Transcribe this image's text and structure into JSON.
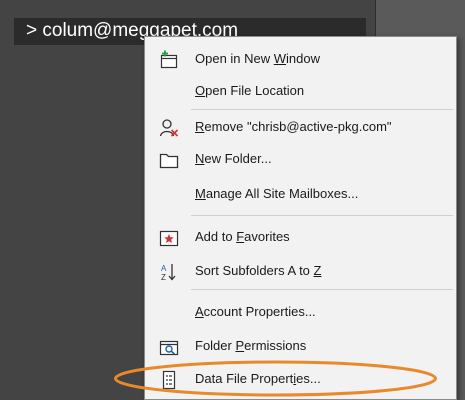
{
  "account": {
    "label": "> colum@meggapet.com"
  },
  "context_menu": {
    "items": [
      {
        "before": "Open in New ",
        "key": "W",
        "after": "indow",
        "icon": "new-window-icon"
      },
      {
        "before": "",
        "key": "O",
        "after": "pen File Location",
        "icon": ""
      },
      {
        "before": "",
        "key": "R",
        "after": "emove \"chrisb@active-pkg.com\"",
        "icon": "remove-account-icon"
      },
      {
        "before": "",
        "key": "N",
        "after": "ew Folder...",
        "icon": "folder-icon"
      },
      {
        "before": "",
        "key": "M",
        "after": "anage All Site Mailboxes...",
        "icon": ""
      },
      {
        "before": "Add to ",
        "key": "F",
        "after": "avorites",
        "icon": "favorites-star-icon"
      },
      {
        "before": "Sort Subfolders A to ",
        "key": "Z",
        "after": "",
        "icon": "sort-az-icon"
      },
      {
        "before": "",
        "key": "A",
        "after": "ccount Properties...",
        "icon": ""
      },
      {
        "before": "Folder ",
        "key": "P",
        "after": "ermissions",
        "icon": "folder-permissions-icon"
      },
      {
        "before": "Data File Propert",
        "key": "i",
        "after": "es...",
        "icon": "data-file-icon"
      }
    ]
  },
  "annotation": {
    "color": "#e8892b",
    "target": "Data File Properties..."
  }
}
